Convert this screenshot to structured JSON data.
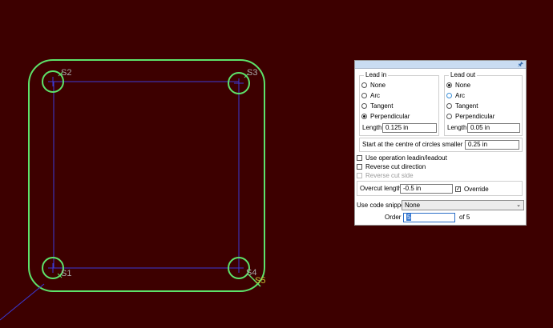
{
  "cad": {
    "labels": [
      "S2",
      "S3",
      "S1",
      "S4",
      "S5"
    ],
    "colors": {
      "background": "#3d0000",
      "profile": "#5de36a",
      "path": "#3a3ad6",
      "start_marker": "#c8c030"
    }
  },
  "panel": {
    "lead_in": {
      "title": "Lead in",
      "options": [
        "None",
        "Arc",
        "Tangent",
        "Perpendicular"
      ],
      "selected": "Perpendicular",
      "length_label": "Length",
      "length_value": "0.125 in"
    },
    "lead_out": {
      "title": "Lead out",
      "options": [
        "None",
        "Arc",
        "Tangent",
        "Perpendicular"
      ],
      "selected": "None",
      "length_label": "Length",
      "length_value": "0.05 in"
    },
    "start_centre_label": "Start at the centre of circles smaller than",
    "start_centre_value": "0.25 in",
    "use_operation_leadin": "Use operation leadin/leadout",
    "reverse_cut_direction": "Reverse cut direction",
    "reverse_cut_side": "Reverse cut side",
    "overcut_label": "Overcut length",
    "overcut_value": "-0.5 in",
    "override_label": "Override",
    "override_checked": true,
    "snippet_label": "Use code snippet",
    "snippet_value": "None",
    "order_label": "Order",
    "order_value": "5",
    "order_of": "of 5"
  }
}
